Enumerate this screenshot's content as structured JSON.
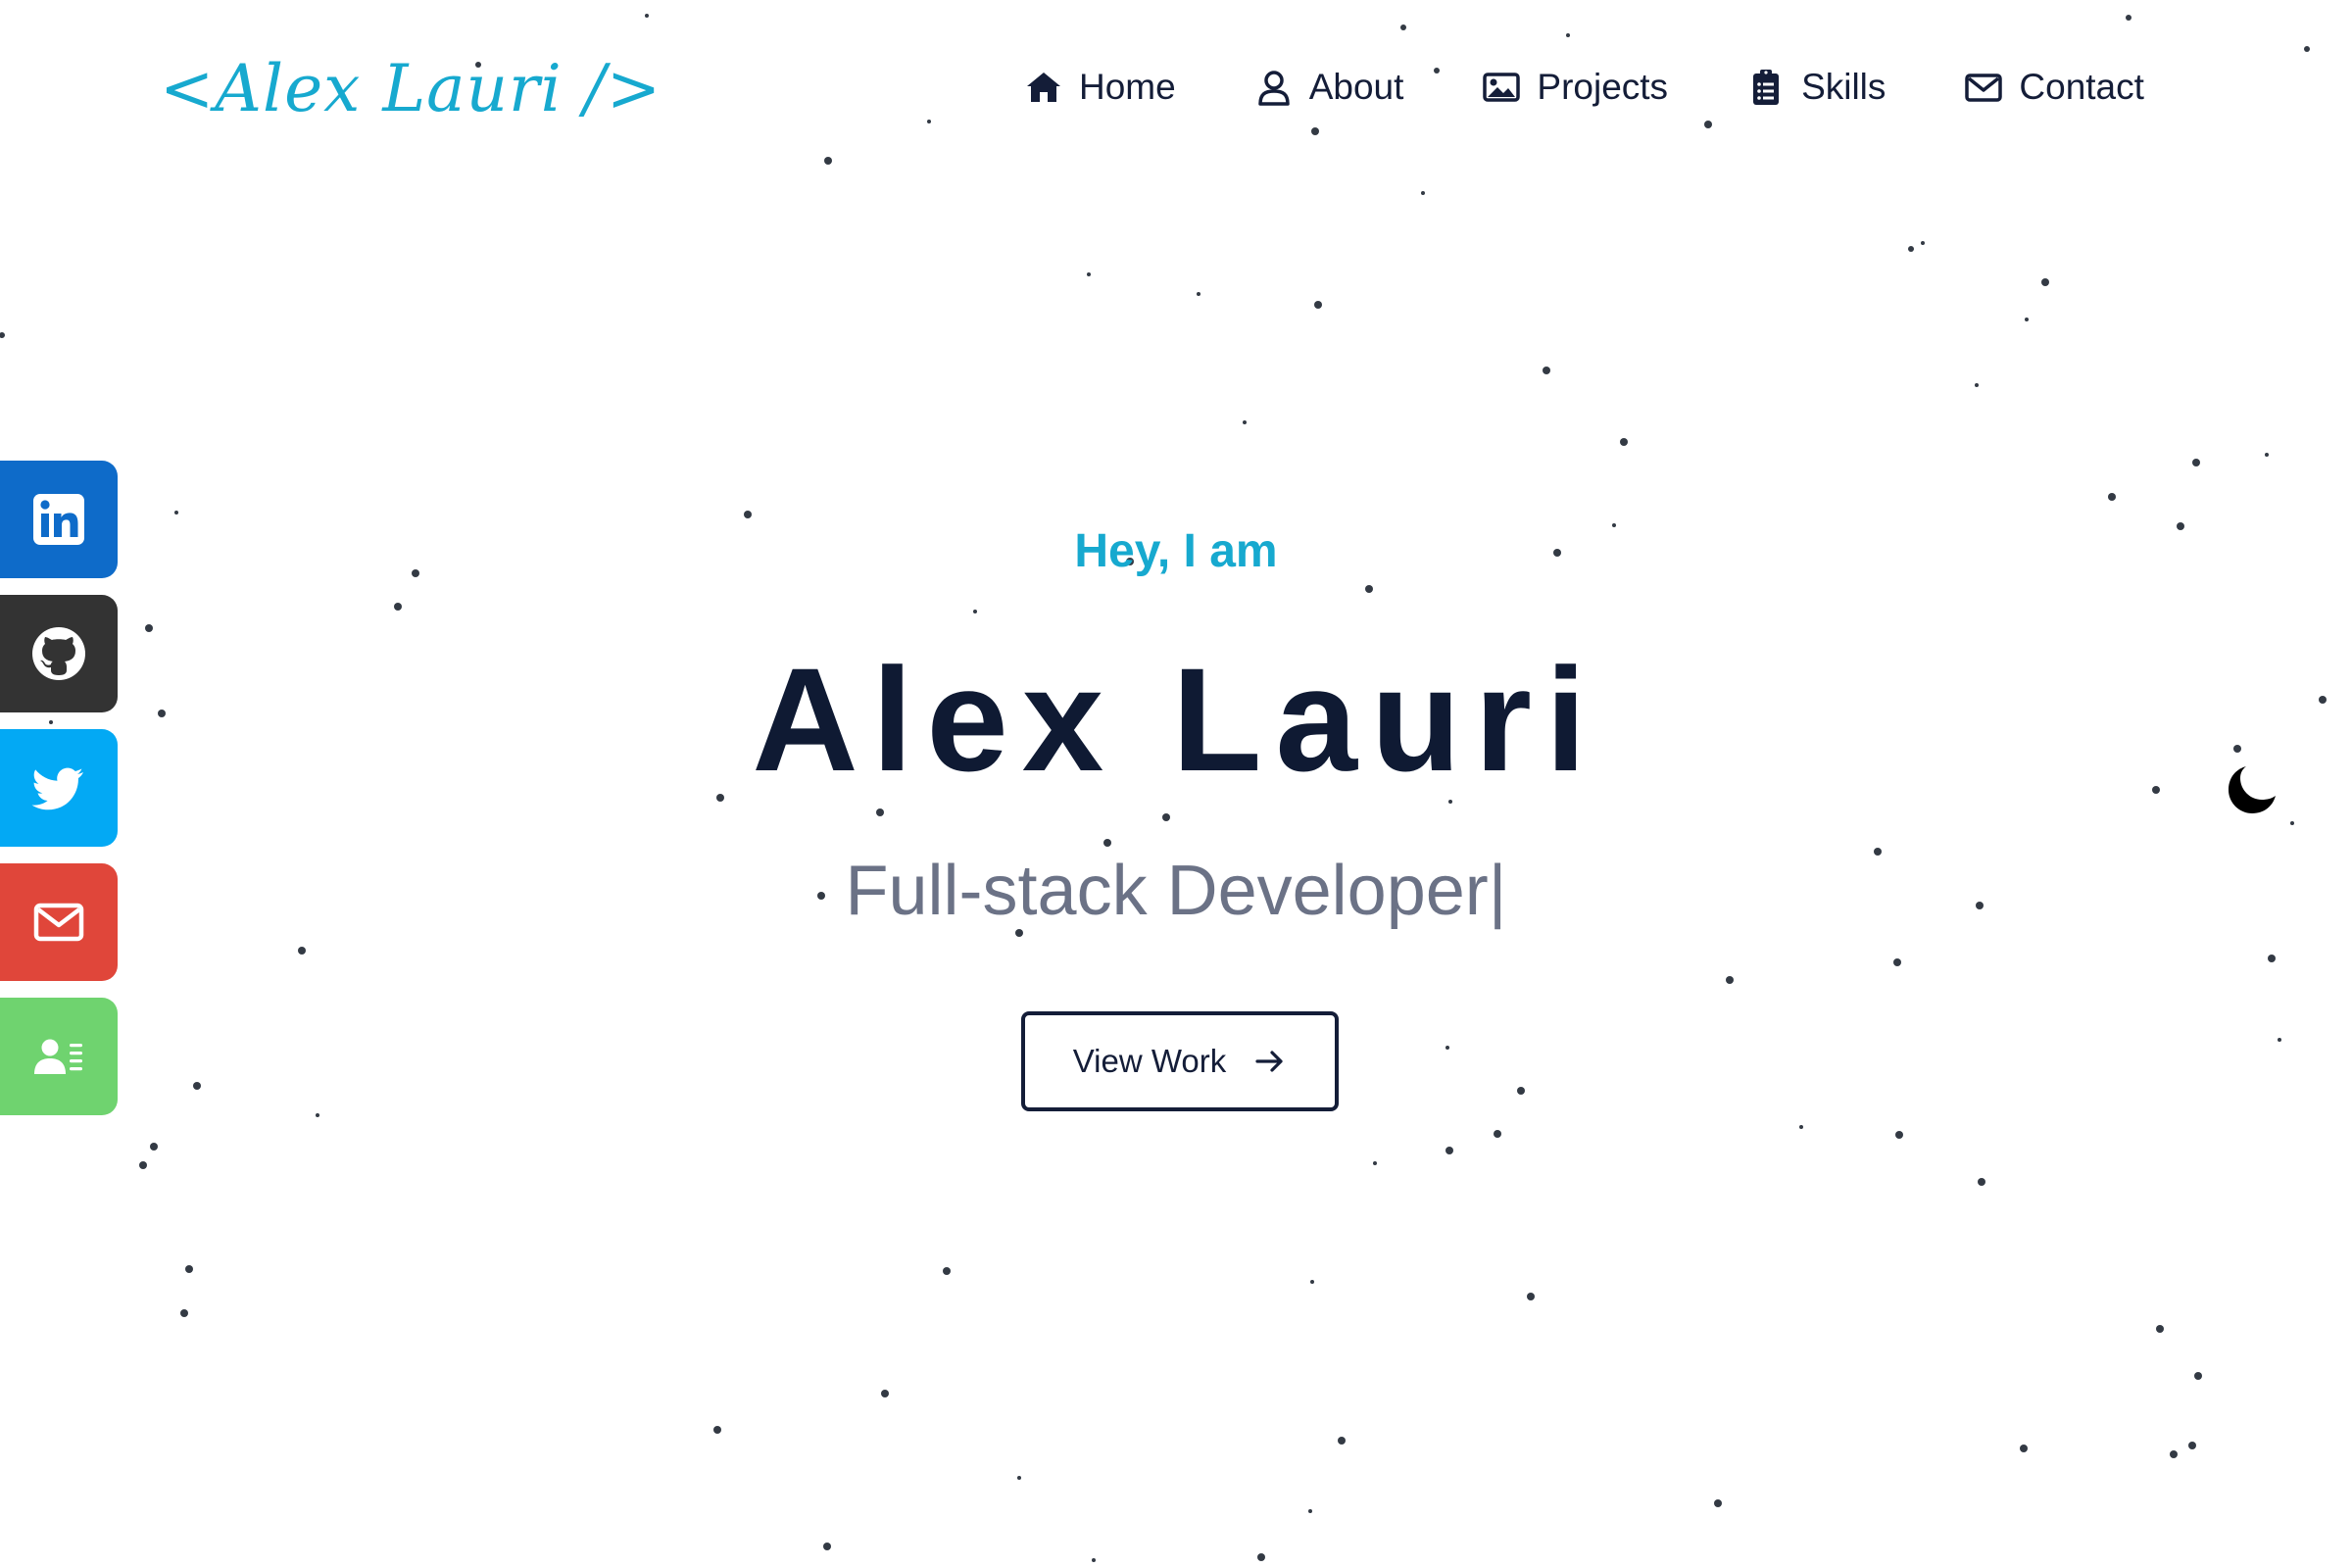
{
  "header": {
    "logo": "<Alex Lauri />",
    "nav": [
      {
        "label": "Home",
        "icon": "home-icon"
      },
      {
        "label": "About",
        "icon": "user-icon"
      },
      {
        "label": "Projects",
        "icon": "image-icon"
      },
      {
        "label": "Skills",
        "icon": "clipboard-list-icon"
      },
      {
        "label": "Contact",
        "icon": "envelope-icon"
      }
    ]
  },
  "social": [
    {
      "name": "LinkedIn",
      "icon": "linkedin-icon",
      "color": "#0e6bc9"
    },
    {
      "name": "GitHub",
      "icon": "github-icon",
      "color": "#333333"
    },
    {
      "name": "Twitter",
      "icon": "twitter-icon",
      "color": "#03a9f4"
    },
    {
      "name": "Email",
      "icon": "envelope-icon",
      "color": "#e0463a"
    },
    {
      "name": "Resume",
      "icon": "address-card-icon",
      "color": "#6fd36f"
    }
  ],
  "hero": {
    "greeting": "Hey, I am",
    "name": "Alex Lauri",
    "role": "Full-stack Developer",
    "cursor": "|",
    "cta_label": "View Work",
    "cta_icon": "arrow-right-icon"
  },
  "theme_toggle": {
    "icon": "moon-icon"
  },
  "colors": {
    "accent": "#17a9cf",
    "heading": "#0f1a33",
    "text": "#141d38",
    "muted": "#6b7286",
    "stars": "#333a44"
  }
}
